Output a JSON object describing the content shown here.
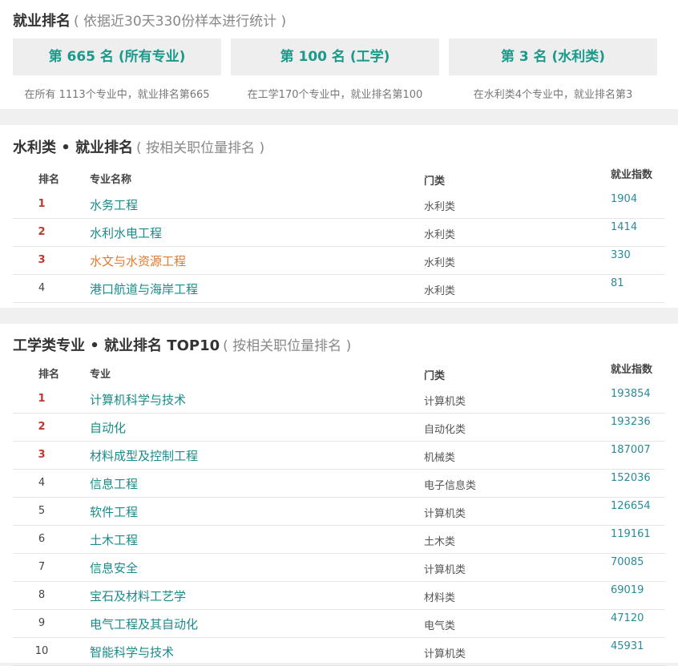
{
  "summary": {
    "title": "就业排名",
    "subtitle": "( 依据近30天330份样本进行统计 )",
    "boxes": [
      {
        "label": "第 665 名 (所有专业)",
        "desc": "在所有 1113个专业中，就业排名第665"
      },
      {
        "label": "第 100 名 (工学)",
        "desc": "在工学170个专业中，就业排名第100"
      },
      {
        "label": "第 3 名 (水利类)",
        "desc": "在水利类4个专业中，就业排名第3"
      }
    ]
  },
  "water": {
    "title": "水利类 • 就业排名",
    "subtitle": "( 按相关职位量排名 )",
    "headers": {
      "rank": "排名",
      "name": "专业名称",
      "category": "门类",
      "index": "就业指数"
    },
    "rows": [
      {
        "rank": "1",
        "name": "水务工程",
        "category": "水利类",
        "index": "1904"
      },
      {
        "rank": "2",
        "name": "水利水电工程",
        "category": "水利类",
        "index": "1414"
      },
      {
        "rank": "3",
        "name": "水文与水资源工程",
        "category": "水利类",
        "index": "330"
      },
      {
        "rank": "4",
        "name": "港口航道与海岸工程",
        "category": "水利类",
        "index": "81"
      }
    ]
  },
  "eng": {
    "title": "工学类专业 • 就业排名 TOP10",
    "subtitle": "( 按相关职位量排名 )",
    "headers": {
      "rank": "排名",
      "name": "专业",
      "category": "门类",
      "index": "就业指数"
    },
    "rows": [
      {
        "rank": "1",
        "name": "计算机科学与技术",
        "category": "计算机类",
        "index": "193854"
      },
      {
        "rank": "2",
        "name": "自动化",
        "category": "自动化类",
        "index": "193236"
      },
      {
        "rank": "3",
        "name": "材料成型及控制工程",
        "category": "机械类",
        "index": "187007"
      },
      {
        "rank": "4",
        "name": "信息工程",
        "category": "电子信息类",
        "index": "152036"
      },
      {
        "rank": "5",
        "name": "软件工程",
        "category": "计算机类",
        "index": "126654"
      },
      {
        "rank": "6",
        "name": "土木工程",
        "category": "土木类",
        "index": "119161"
      },
      {
        "rank": "7",
        "name": "信息安全",
        "category": "计算机类",
        "index": "70085"
      },
      {
        "rank": "8",
        "name": "宝石及材料工艺学",
        "category": "材料类",
        "index": "69019"
      },
      {
        "rank": "9",
        "name": "电气工程及其自动化",
        "category": "电气类",
        "index": "47120"
      },
      {
        "rank": "10",
        "name": "智能科学与技术",
        "category": "计算机类",
        "index": "45931"
      }
    ]
  },
  "colors": {
    "accent": "#1a9a8a",
    "top_rank": "#c0392b",
    "highlight": "#e07a2e"
  }
}
